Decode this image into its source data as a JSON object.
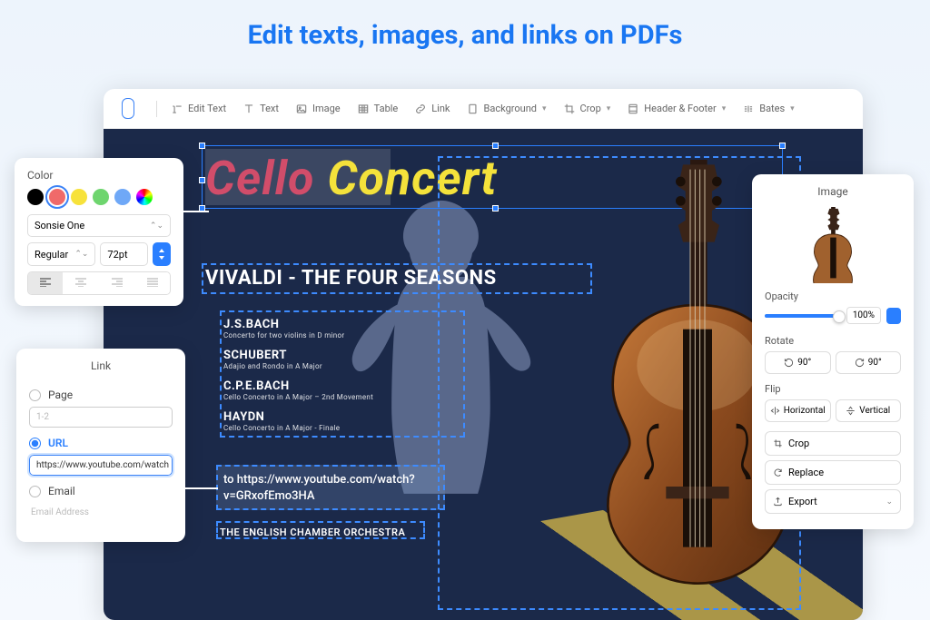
{
  "headline": "Edit texts, images, and links on PDFs",
  "toolbar": {
    "edit_text": "Edit Text",
    "text": "Text",
    "image": "Image",
    "table": "Table",
    "link": "Link",
    "background": "Background",
    "crop": "Crop",
    "header_footer": "Header & Footer",
    "bates": "Bates"
  },
  "document": {
    "title_part1": "Cello",
    "title_part2": "Concert",
    "subtitle": "VIVALDI - THE FOUR SEASONS",
    "composers": [
      {
        "name": "J.S.BACH",
        "desc": "Concerto for two violins in D minor"
      },
      {
        "name": "SCHUBERT",
        "desc": "Adajio and Rondo in A Major"
      },
      {
        "name": "C.P.E.BACH",
        "desc": "Cello Concerto in A Major – 2nd Movement"
      },
      {
        "name": "HAYDN",
        "desc": "Cello Concerto in A Major - Finale"
      }
    ],
    "link_text_1": "to https://www.youtube.com/watch?",
    "link_text_2": "v=GRxofEmo3HA",
    "orchestra": "THE ENGLISH CHAMBER ORCHESTRA"
  },
  "color_panel": {
    "title": "Color",
    "font": "Sonsie One",
    "weight": "Regular",
    "size": "72pt",
    "colors": [
      "#000000",
      "#f06a6a",
      "#f7e23b",
      "#6ed56e",
      "#6fa8f7",
      "conic"
    ]
  },
  "link_panel": {
    "title": "Link",
    "page_label": "Page",
    "page_placeholder": "1-2",
    "url_label": "URL",
    "url_value": "https://www.youtube.com/watch",
    "email_label": "Email",
    "email_placeholder": "Email Address"
  },
  "image_panel": {
    "title": "Image",
    "opacity_label": "Opacity",
    "opacity_value": "100%",
    "rotate_label": "Rotate",
    "rotate_ccw": "90°",
    "rotate_cw": "90°",
    "flip_label": "Flip",
    "flip_h": "Horizontal",
    "flip_v": "Vertical",
    "crop": "Crop",
    "replace": "Replace",
    "export": "Export"
  }
}
